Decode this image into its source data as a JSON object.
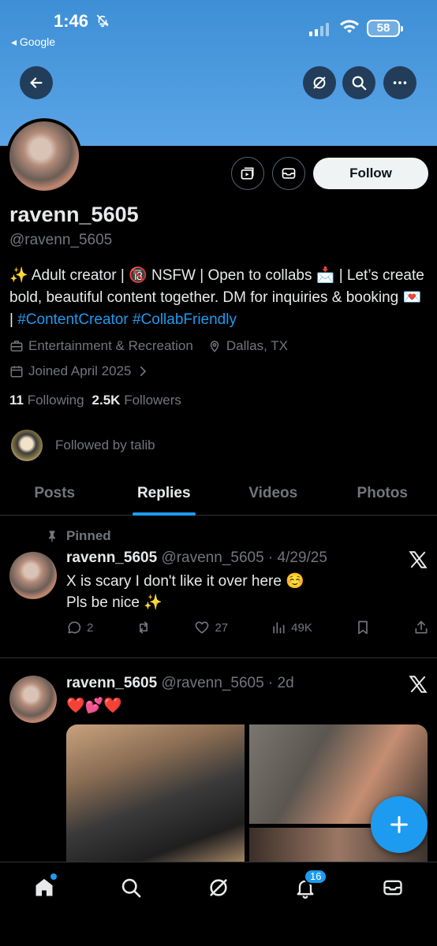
{
  "status_bar": {
    "time": "1:46",
    "back_app": "◂ Google",
    "battery": "58"
  },
  "profile": {
    "display_name": "ravenn_5605",
    "handle": "@ravenn_5605",
    "follow_label": "Follow",
    "bio_text": "✨ Adult creator | 🔞 NSFW | Open to collabs 📩 | Let’s create bold, beautiful content together. DM for inquiries & booking 💌 | ",
    "bio_tags": "#ContentCreator #CollabFriendly",
    "category": "Entertainment & Recreation",
    "location": "Dallas, TX",
    "joined": "Joined April 2025",
    "following_count": "11",
    "following_label": "Following",
    "followers_count": "2.5K",
    "followers_label": "Followers",
    "followed_by": "Followed by talib"
  },
  "tabs": [
    {
      "label": "Posts"
    },
    {
      "label": "Replies"
    },
    {
      "label": "Videos"
    },
    {
      "label": "Photos"
    }
  ],
  "posts": [
    {
      "pinned_label": "Pinned",
      "name": "ravenn_5605",
      "meta": "@ravenn_5605 · 4/29/25",
      "line1": "X is scary I don't like it over here ☺️",
      "line2": "Pls be nice ✨",
      "replies": "2",
      "likes": "27",
      "views": "49K"
    },
    {
      "name": "ravenn_5605",
      "meta": "@ravenn_5605 · 2d",
      "line1": "❤️💕❤️"
    }
  ],
  "nav": {
    "notifications_badge": "16"
  },
  "colors": {
    "accent": "#1d9bf0",
    "background": "#000000",
    "banner": "#4a98dd"
  }
}
